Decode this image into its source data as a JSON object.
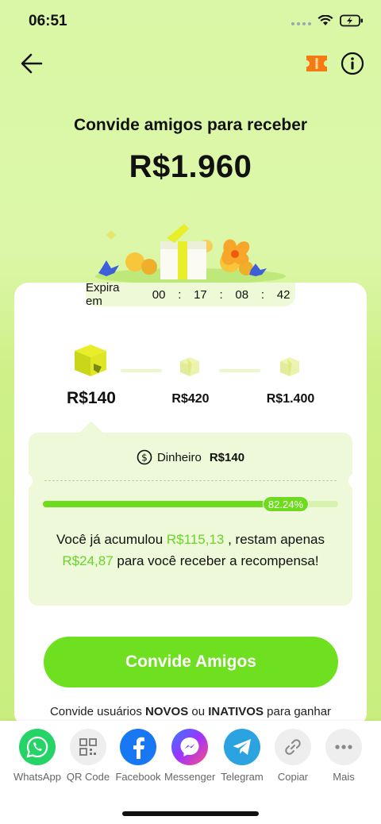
{
  "status": {
    "time": "06:51"
  },
  "header": {
    "title": "Convide amigos para receber",
    "amount": "R$1.960"
  },
  "timer": {
    "label": "Expira em",
    "hours": "00",
    "minutes": "17",
    "seconds": "08",
    "centis": "42",
    "separator": ":"
  },
  "steps": [
    {
      "label": "R$140",
      "active": true
    },
    {
      "label": "R$420",
      "active": false
    },
    {
      "label": "R$1.400",
      "active": false
    }
  ],
  "reward": {
    "cash_label": "Dinheiro",
    "cash_value": "R$140"
  },
  "progress": {
    "percent_label": "82.24%",
    "fraction": 0.8224
  },
  "accumulated": {
    "prefix": "Você já acumulou ",
    "amount": "R$115,13",
    "middle": " , restam apenas ",
    "remaining": "R$24,87",
    "suffix": " para você receber a recompensa!"
  },
  "cta": {
    "label": "Convide Amigos"
  },
  "hint": {
    "prefix": "Convide usuários ",
    "novos": "NOVOS",
    "ou": " ou ",
    "inativos": "INATIVOS",
    "suffix": " para ganhar"
  },
  "share": [
    {
      "label": "WhatsApp",
      "icon": "whatsapp-icon",
      "color": "#25d366"
    },
    {
      "label": "QR Code",
      "icon": "qr-code-icon",
      "color": "#eeeeee"
    },
    {
      "label": "Facebook",
      "icon": "facebook-icon",
      "color": "#1877f2"
    },
    {
      "label": "Messenger",
      "icon": "messenger-icon",
      "color": "#a033ff"
    },
    {
      "label": "Telegram",
      "icon": "telegram-icon",
      "color": "#2aa3e0"
    },
    {
      "label": "Copiar",
      "icon": "link-icon",
      "color": "#eeeeee"
    },
    {
      "label": "Mais",
      "icon": "more-icon",
      "color": "#eeeeee"
    }
  ],
  "colors": {
    "accent": "#6ee020",
    "highlight": "#6bd32a",
    "background": "#d9f7a6"
  }
}
